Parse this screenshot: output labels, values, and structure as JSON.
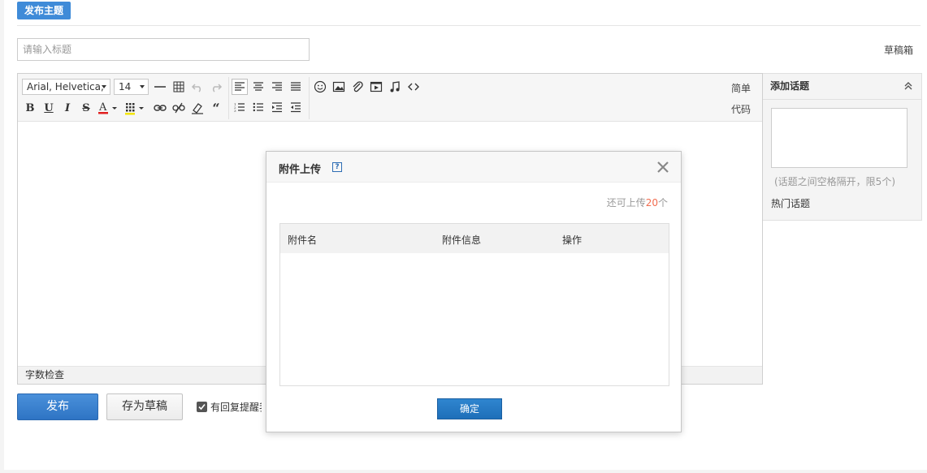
{
  "header": {
    "tag": "发布主题",
    "title_placeholder": "请输入标题",
    "drafts_label": "草稿箱"
  },
  "toolbar": {
    "font_family": "Arial, Helvetica,",
    "font_size": "14",
    "simple_mode": "简单",
    "code_label": "代码"
  },
  "editor": {
    "word_count": "字数检查"
  },
  "topic_panel": {
    "title": "添加话题",
    "hint": "(话题之间空格隔开，限5个)",
    "hot_topics": "热门话题"
  },
  "actions": {
    "publish": "发布",
    "save_draft": "存为草稿",
    "notify_label": "有回复提醒我"
  },
  "dialog": {
    "title": "附件上传",
    "remaining_prefix": "还可上传",
    "remaining_count": "20",
    "remaining_suffix": "个",
    "columns": [
      "附件名",
      "附件信息",
      "操作"
    ],
    "ok_label": "确定"
  }
}
